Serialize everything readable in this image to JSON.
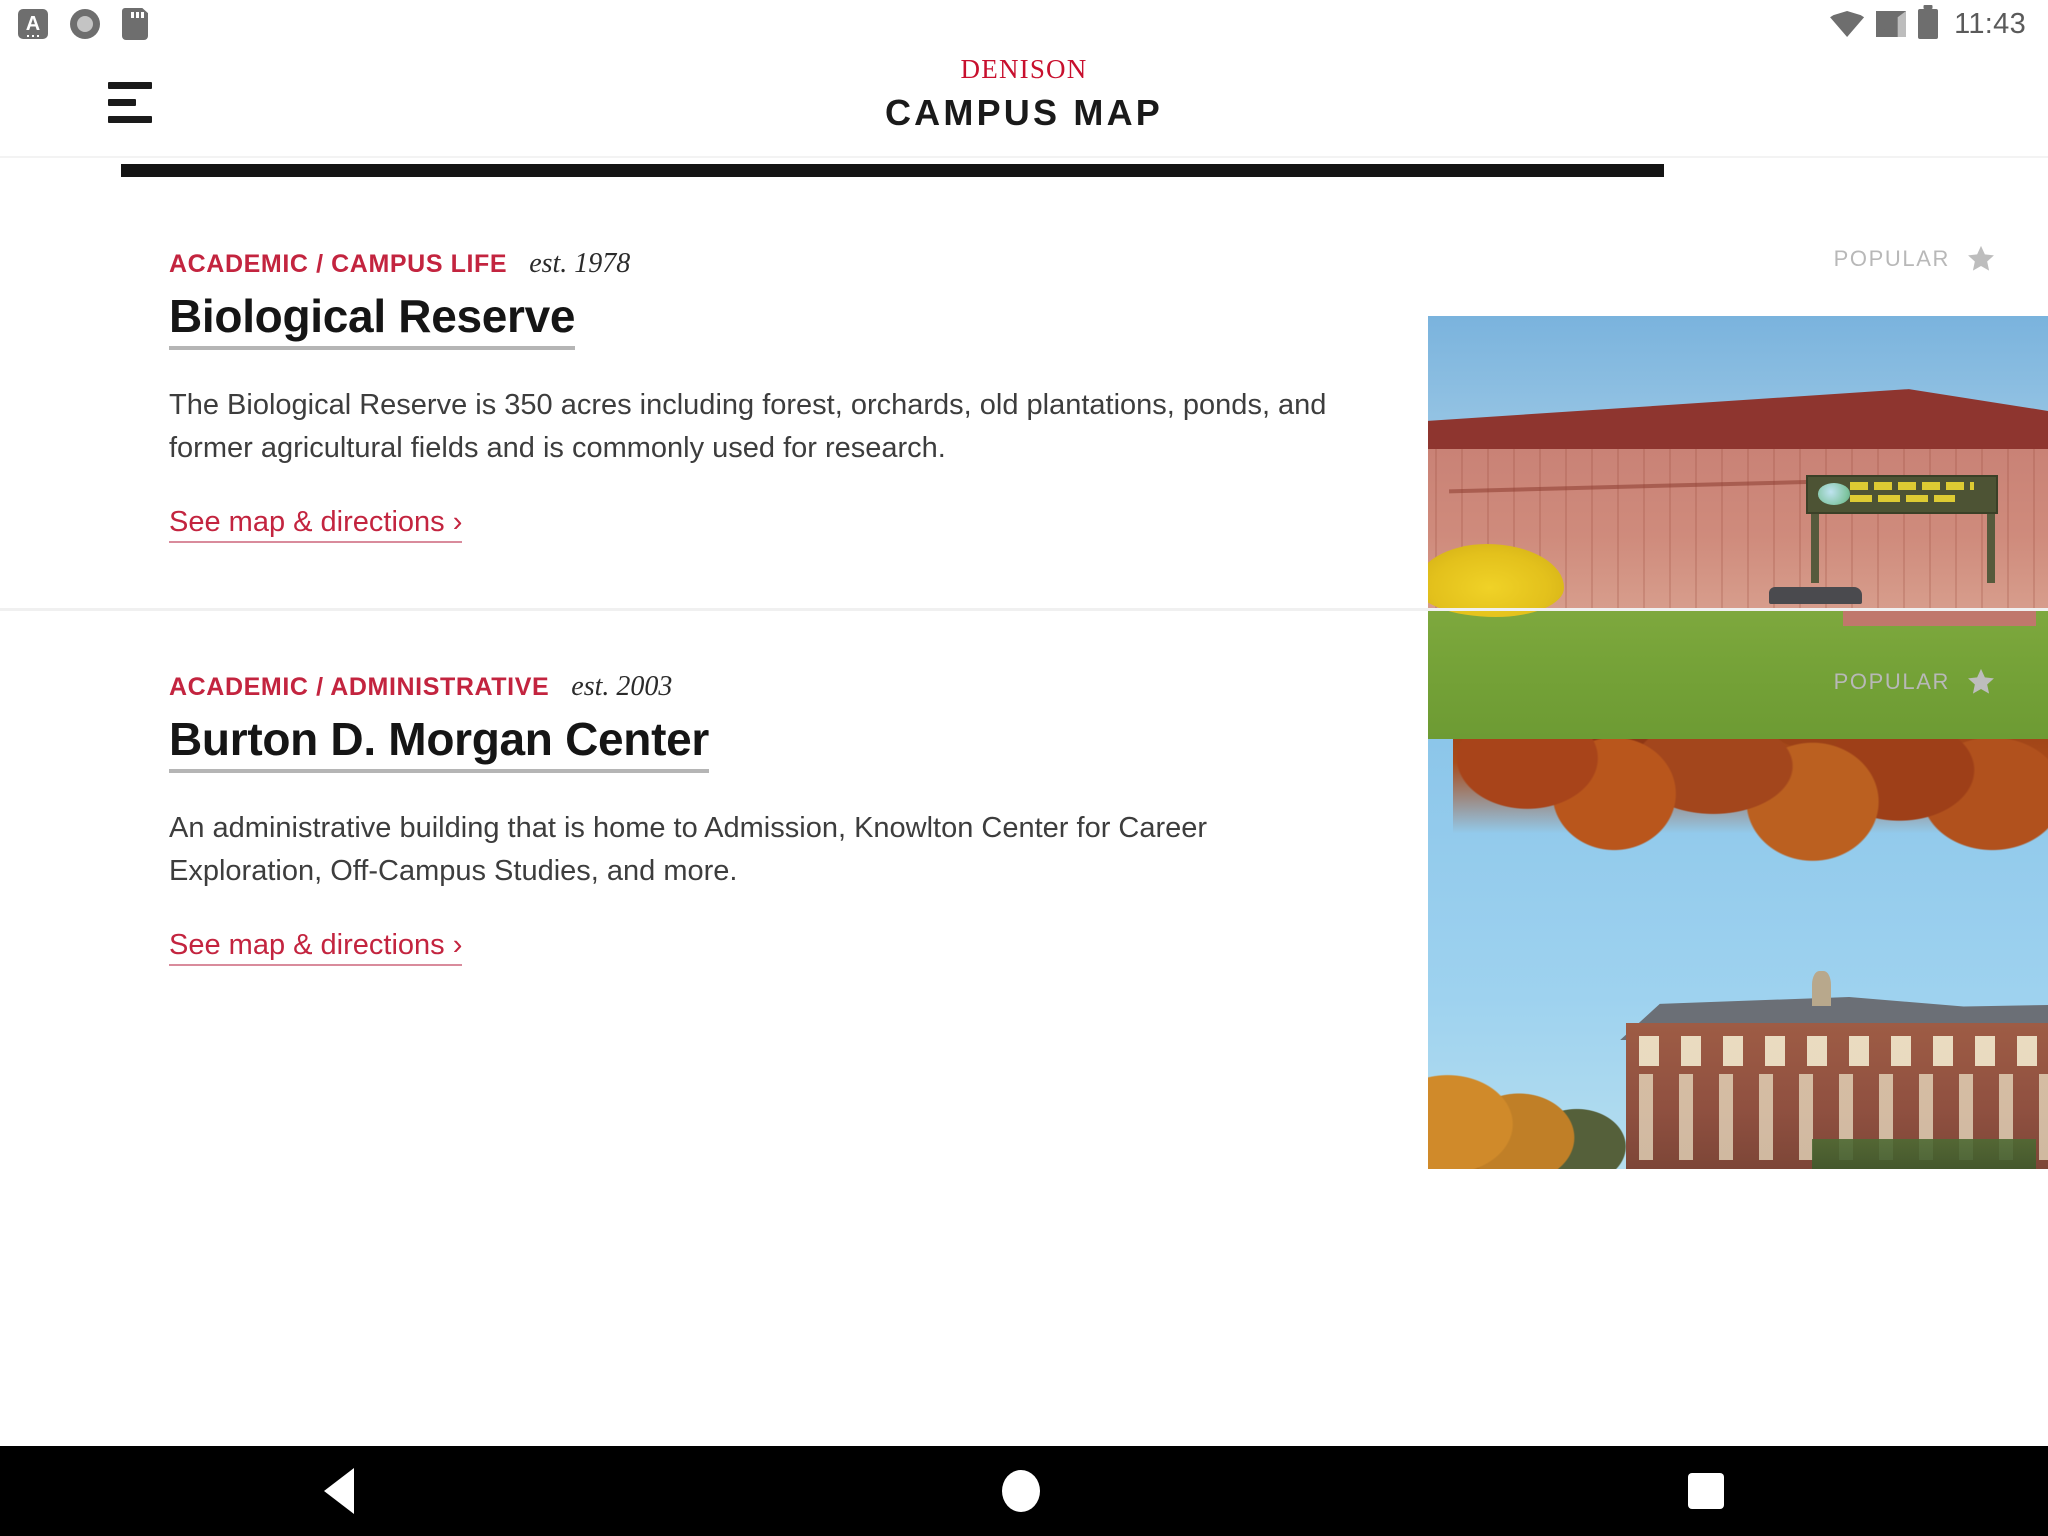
{
  "status_bar": {
    "icons_left": [
      "notification-a-icon",
      "record-circle-icon",
      "sd-card-icon"
    ],
    "icons_right": [
      "wifi-icon",
      "cell-signal-icon",
      "battery-icon"
    ],
    "clock": "11:43"
  },
  "header": {
    "menu_icon": "hamburger-menu-icon",
    "brand_wordmark": "DENISON",
    "brand_title": "CAMPUS MAP"
  },
  "accent_color": "#c3243f",
  "cards": [
    {
      "category": "ACADEMIC / CAMPUS LIFE",
      "established": "est. 1978",
      "title": "Biological Reserve",
      "description": "The Biological Reserve is 350 acres including forest, orchards, old plantations, ponds, and former agricultural fields and is commonly used for research.",
      "link_label": "See map & directions ›",
      "badge_label": "POPULAR",
      "badge_icon": "star-icon",
      "photo_alt": "red-barn-photo"
    },
    {
      "category": "ACADEMIC / ADMINISTRATIVE",
      "established": "est. 2003",
      "title": "Burton D. Morgan Center",
      "description": "An administrative building that is home to Admission, Knowlton Center for Career Exploration, Off-Campus Studies, and more.",
      "link_label": "See map & directions ›",
      "badge_label": "POPULAR",
      "badge_icon": "star-icon",
      "photo_alt": "campus-building-autumn-photo"
    }
  ],
  "nav_bar": {
    "back": "back-icon",
    "home": "home-icon",
    "recents": "recents-icon"
  }
}
